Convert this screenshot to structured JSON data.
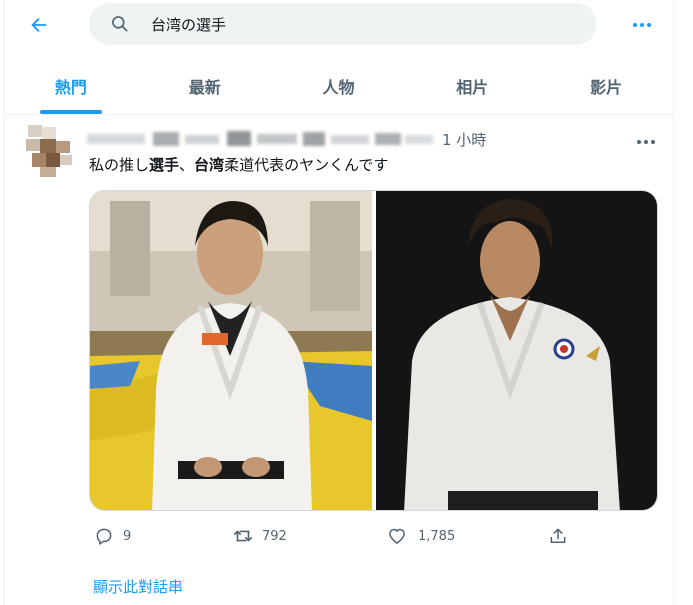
{
  "topbar": {
    "back_icon": "arrow-left-icon",
    "search_icon": "search-icon",
    "search_value": "台湾の選手",
    "more_icon": "more-horizontal-icon",
    "accent": "#1d9bf0"
  },
  "tabs": [
    {
      "label": "熱門",
      "active": true
    },
    {
      "label": "最新",
      "active": false
    },
    {
      "label": "人物",
      "active": false
    },
    {
      "label": "相片",
      "active": false
    },
    {
      "label": "影片",
      "active": false
    }
  ],
  "tweet": {
    "time": "1 小時",
    "text_parts": [
      "私の推し",
      "選手",
      "、",
      "台湾",
      "柔道代表のヤンくんです"
    ],
    "images": [
      {
        "description_icon": "photo-judo-athlete-dojo"
      },
      {
        "description_icon": "photo-judo-athlete-portrait"
      }
    ],
    "actions": {
      "reply_icon": "reply-icon",
      "reply_count": "9",
      "retweet_icon": "retweet-icon",
      "retweet_count": "792",
      "like_icon": "heart-icon",
      "like_count": "1,785",
      "share_icon": "share-icon"
    },
    "show_thread": "顯示此對話串"
  }
}
